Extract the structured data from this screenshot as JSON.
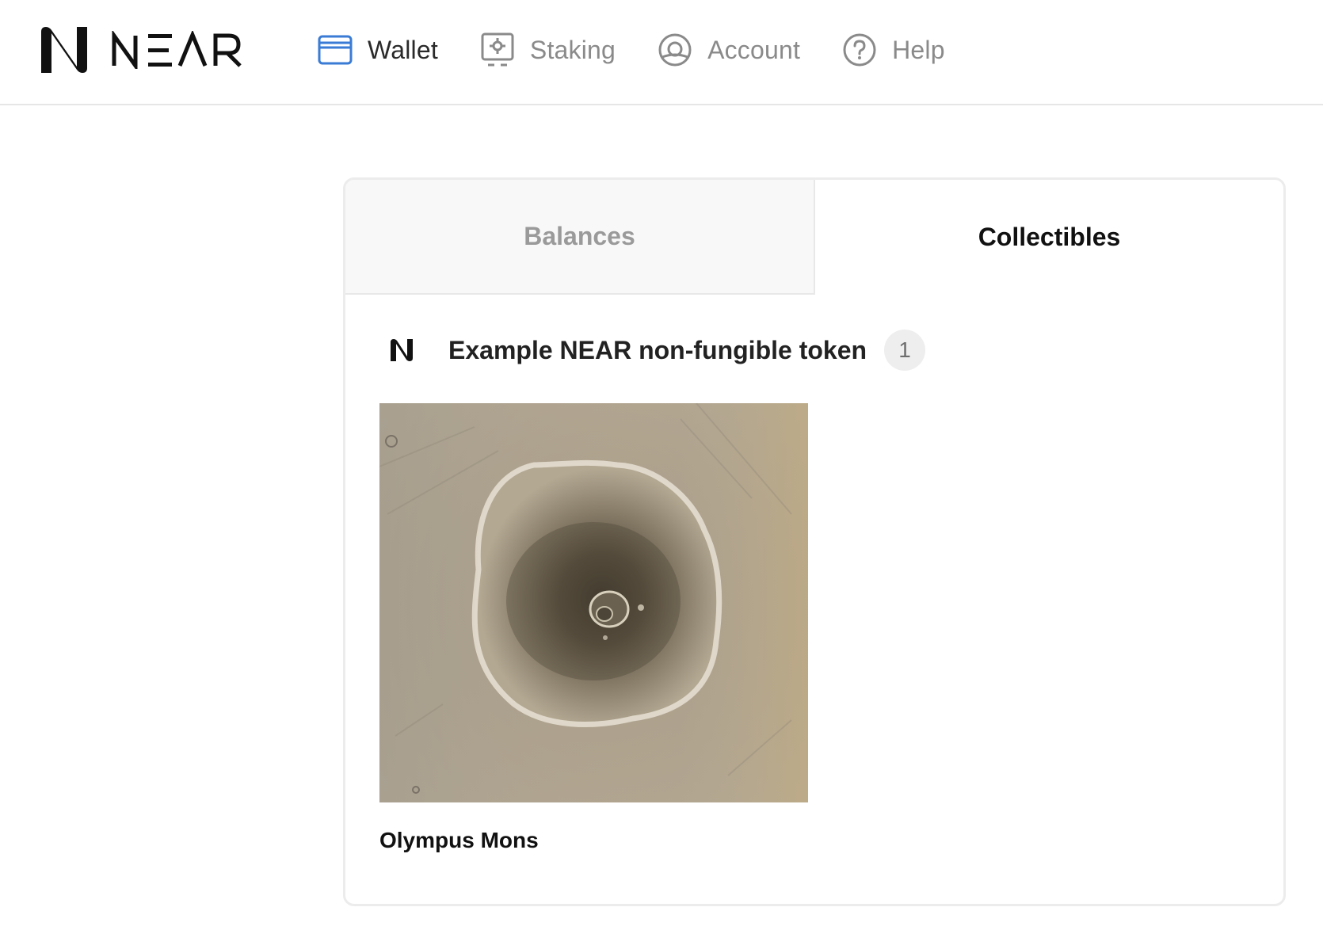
{
  "brand": {
    "name": "NEAR",
    "logo_icon": "near-logo-icon"
  },
  "nav": {
    "items": [
      {
        "label": "Wallet",
        "icon": "wallet-icon",
        "active": true
      },
      {
        "label": "Staking",
        "icon": "staking-icon",
        "active": false
      },
      {
        "label": "Account",
        "icon": "account-icon",
        "active": false
      },
      {
        "label": "Help",
        "icon": "help-icon",
        "active": false
      }
    ]
  },
  "tabs": [
    {
      "label": "Balances",
      "active": false
    },
    {
      "label": "Collectibles",
      "active": true
    }
  ],
  "collection": {
    "icon": "near-logo-icon",
    "title": "Example NEAR non-fungible token",
    "count": "1",
    "tokens": [
      {
        "name": "Olympus Mons",
        "image": "olympus-mons-image"
      }
    ]
  },
  "colors": {
    "accent_blue": "#3a7bd5",
    "active_text": "#111111",
    "muted_text": "#8a8a8a",
    "inactive_tab_bg": "#f8f8f8",
    "badge_bg": "#eeeeee",
    "border": "#ececec"
  }
}
